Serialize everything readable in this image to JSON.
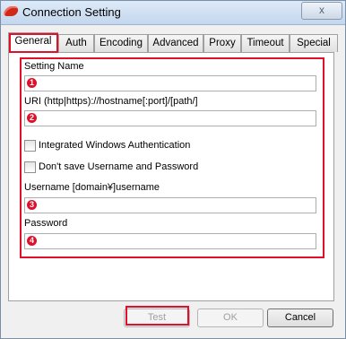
{
  "window": {
    "title": "Connection Setting",
    "close_glyph": "x"
  },
  "tabs": [
    {
      "label": "General",
      "active": true
    },
    {
      "label": "Auth"
    },
    {
      "label": "Encoding"
    },
    {
      "label": "Advanced"
    },
    {
      "label": "Proxy"
    },
    {
      "label": "Timeout"
    },
    {
      "label": "Special"
    }
  ],
  "general": {
    "setting_name": {
      "label": "Setting Name",
      "marker": "1",
      "value": ""
    },
    "uri": {
      "label": "URI  (http|https)://hostname[:port]/[path/]",
      "marker": "2",
      "value": ""
    },
    "integrated_windows_auth": {
      "label": "Integrated Windows Authentication",
      "checked": false
    },
    "dont_save_credentials": {
      "label": "Don't save Username and Password",
      "checked": false
    },
    "username": {
      "label": "Username   [domain¥]username",
      "marker": "3",
      "value": ""
    },
    "password": {
      "label": "Password",
      "marker": "4",
      "value": ""
    }
  },
  "buttons": {
    "test": "Test",
    "ok": "OK",
    "cancel": "Cancel"
  },
  "colors": {
    "highlight": "#e0102a",
    "title_bar": "#c4d7ee"
  }
}
